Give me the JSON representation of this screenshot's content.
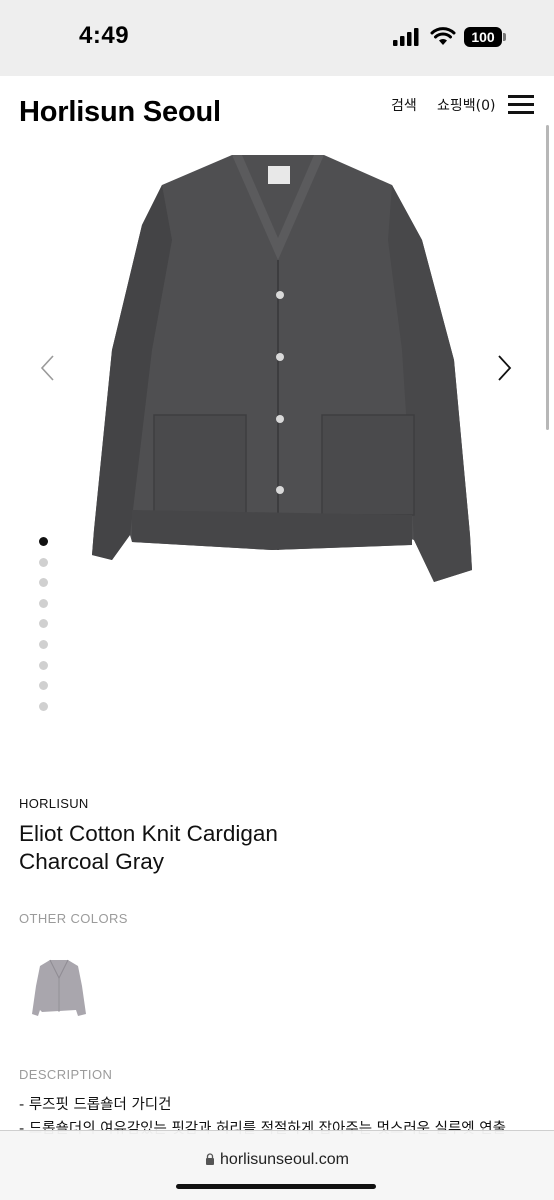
{
  "status_bar": {
    "time": "4:49",
    "battery": "100"
  },
  "header": {
    "brand": "Horlisun Seoul",
    "search_label": "검색",
    "bag_label": "쇼핑백(0)"
  },
  "carousel": {
    "total_images": 9,
    "active_index": 0
  },
  "product": {
    "vendor": "HORLISUN",
    "title_line1": "Eliot Cotton Knit Cardigan",
    "title_line2": "Charcoal Gray",
    "other_colors_label": "OTHER COLORS",
    "description_label": "DESCRIPTION",
    "description_lines": [
      "- 루즈핏 드롭숄더 가디건",
      "- 드롭숄더의 여유감있는 핏감과 허리를 적절하게 잡아주는 멋스러운 실루엣 연출"
    ]
  },
  "browser": {
    "url": "horlisunseoul.com"
  },
  "colors": {
    "product": "#4f4f51",
    "swatch": "#a9a6ad",
    "dot_active": "#111111",
    "dot_inactive": "#d0d0d0"
  }
}
